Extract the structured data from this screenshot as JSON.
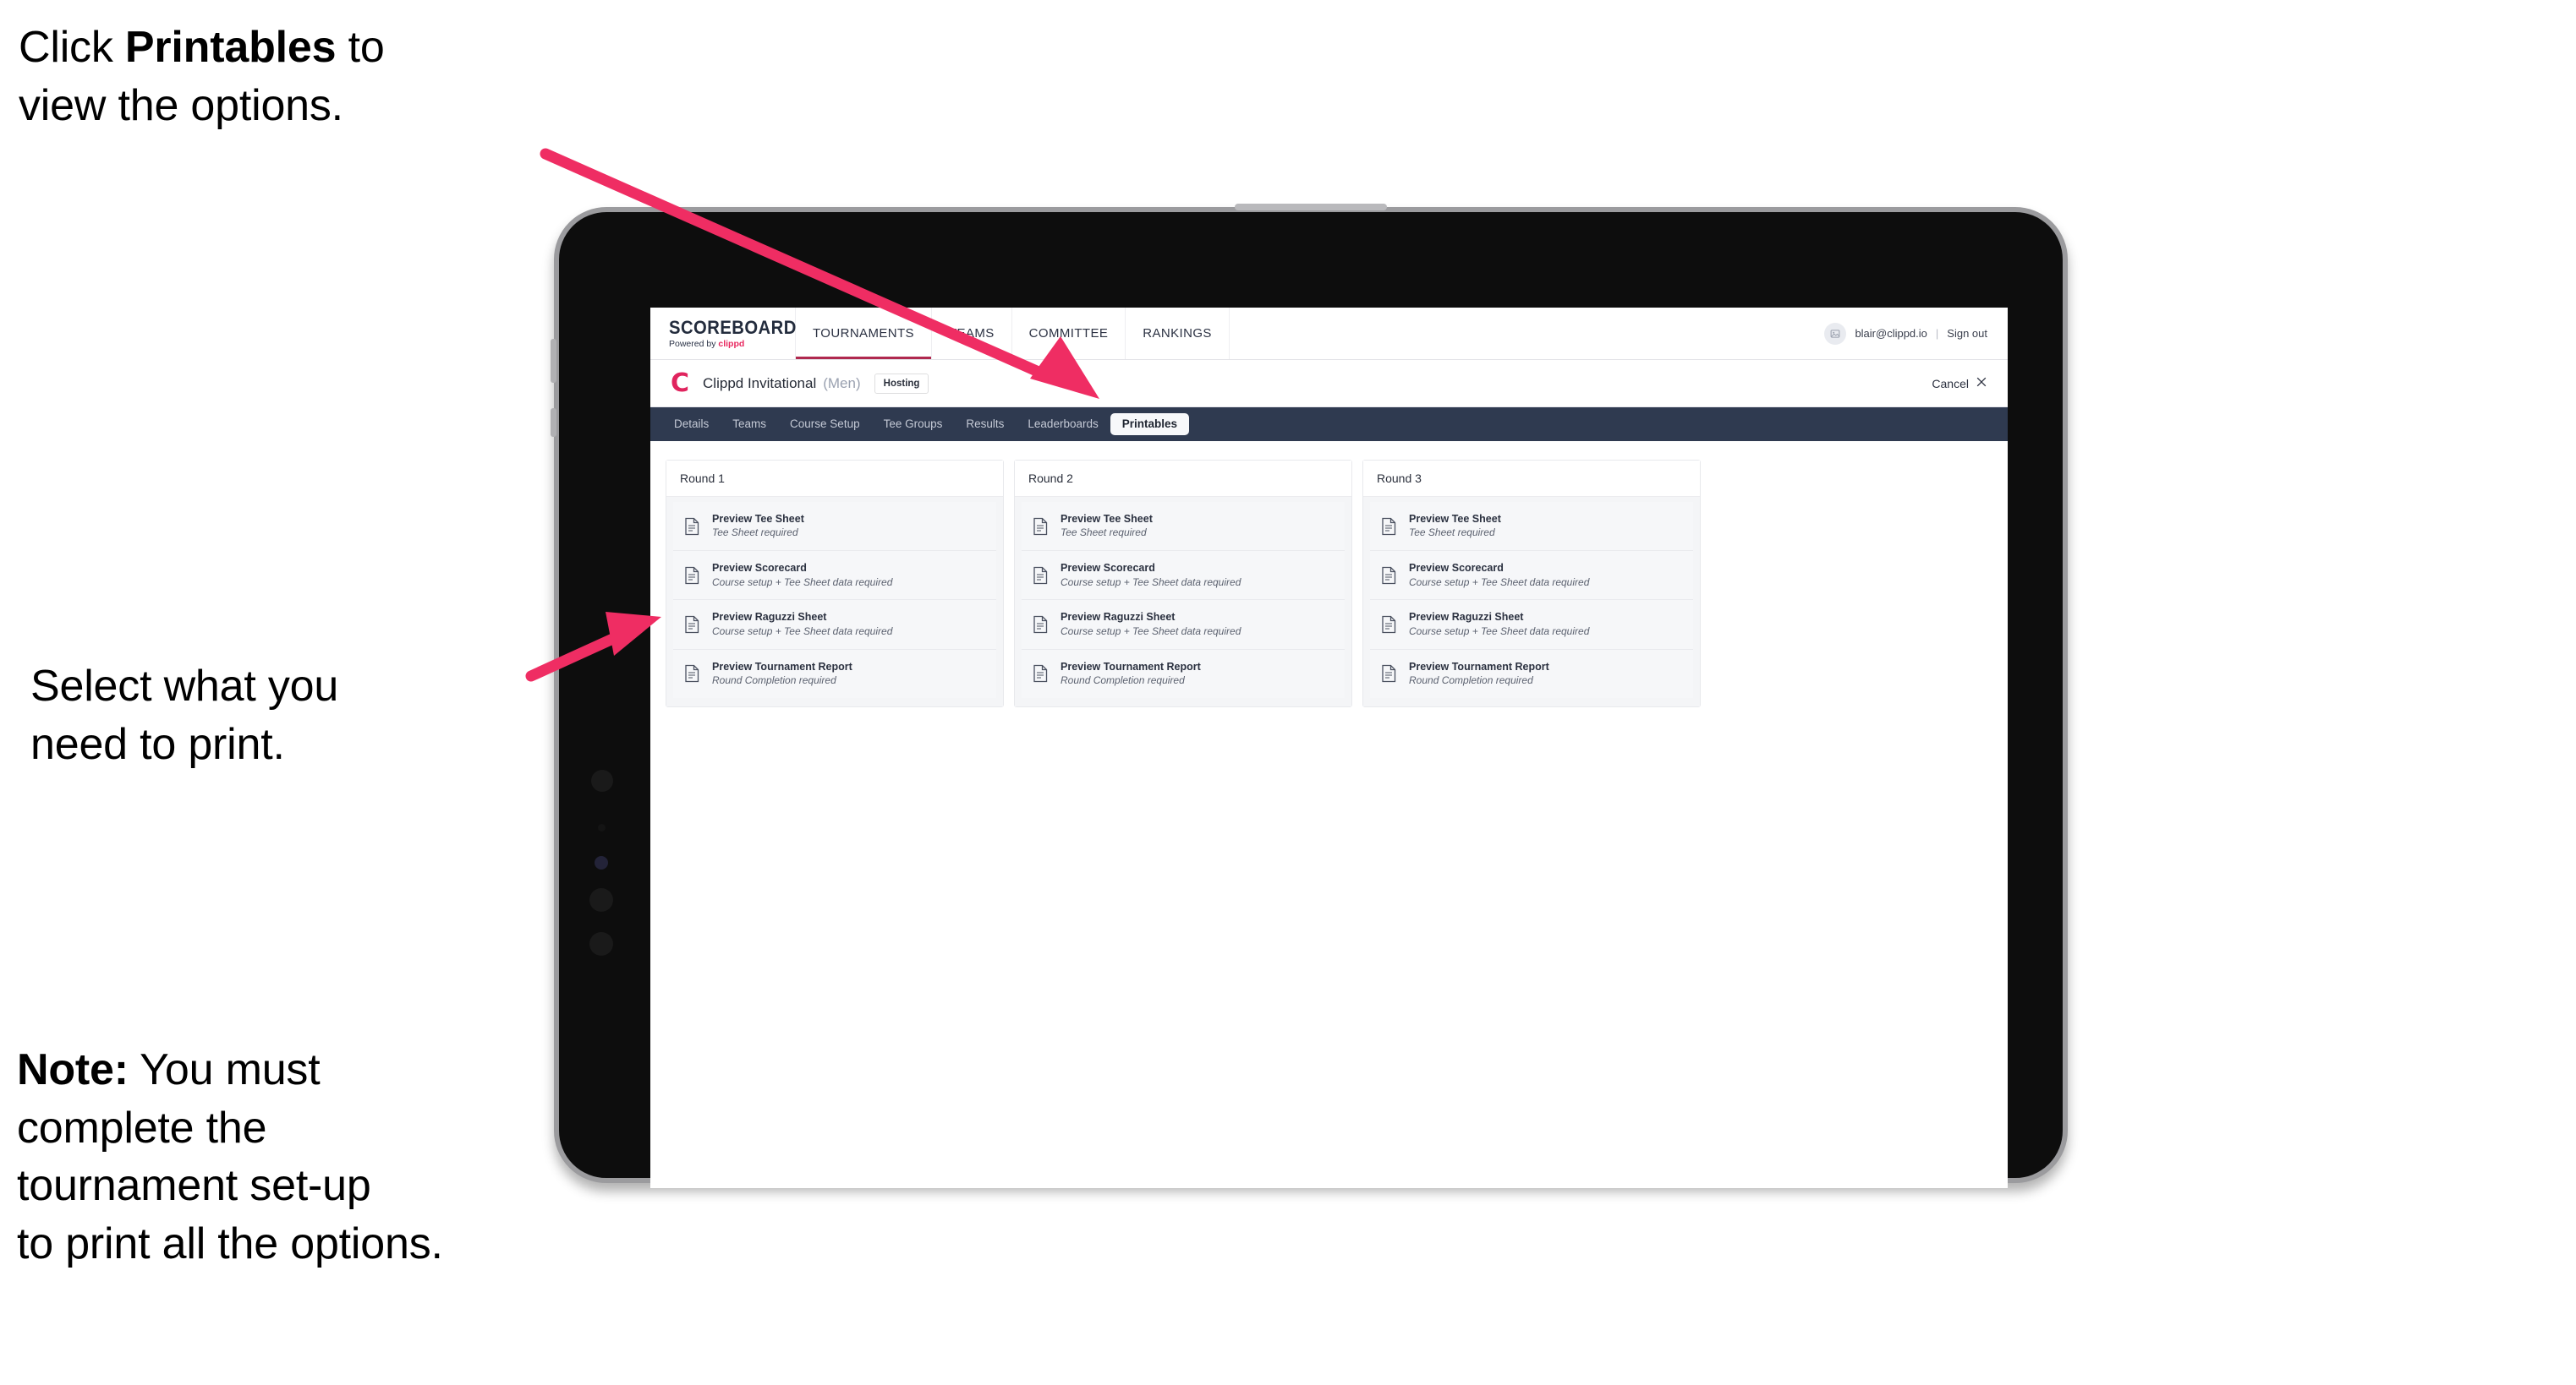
{
  "annotations": {
    "printables_hint": "Click Printables to\nview the options.",
    "printables_hint_pre": "Click ",
    "printables_hint_bold": "Printables",
    "printables_hint_post": " to\nview the options.",
    "select_hint": "Select what you\n need to print.",
    "note_label": "Note:",
    "note_body": " You must\ncomplete the\ntournament set-up\nto print all the options."
  },
  "colors": {
    "accent_pink": "#ef2d63",
    "brand_red": "#e0245e",
    "tabbar_dark": "#2f3a50",
    "nav_underline": "#b0294f",
    "text_dark": "#2b3140"
  },
  "browser": {
    "topnav": {
      "logo_word": "SCOREBOARD",
      "logo_sub_prefix": "Powered by ",
      "logo_sub_brand": "clippd",
      "items": [
        {
          "label": "TOURNAMENTS",
          "active": true
        },
        {
          "label": "TEAMS",
          "active": false
        },
        {
          "label": "COMMITTEE",
          "active": false
        },
        {
          "label": "RANKINGS",
          "active": false
        }
      ],
      "account": {
        "avatar_icon": "user-avatar-icon",
        "email": "blair@clippd.io",
        "separator": "|",
        "signout_label": "Sign out"
      }
    },
    "subheader": {
      "logo_letter": "C",
      "tournament_name": "Clippd Invitational",
      "gender": "(Men)",
      "status_badge": "Hosting",
      "cancel_label": "Cancel",
      "cancel_icon": "close-x-icon"
    },
    "tabs": [
      {
        "label": "Details",
        "active": false
      },
      {
        "label": "Teams",
        "active": false
      },
      {
        "label": "Course Setup",
        "active": false
      },
      {
        "label": "Tee Groups",
        "active": false
      },
      {
        "label": "Results",
        "active": false
      },
      {
        "label": "Leaderboards",
        "active": false
      },
      {
        "label": "Printables",
        "active": true
      }
    ],
    "rounds": [
      {
        "title": "Round 1",
        "items": [
          {
            "icon": "document-icon",
            "title": "Preview Tee Sheet",
            "subtitle": "Tee Sheet required"
          },
          {
            "icon": "document-icon",
            "title": "Preview Scorecard",
            "subtitle": "Course setup + Tee Sheet data required"
          },
          {
            "icon": "document-icon",
            "title": "Preview Raguzzi Sheet",
            "subtitle": "Course setup + Tee Sheet data required"
          },
          {
            "icon": "document-icon",
            "title": "Preview Tournament Report",
            "subtitle": "Round Completion required"
          }
        ]
      },
      {
        "title": "Round 2",
        "items": [
          {
            "icon": "document-icon",
            "title": "Preview Tee Sheet",
            "subtitle": "Tee Sheet required"
          },
          {
            "icon": "document-icon",
            "title": "Preview Scorecard",
            "subtitle": "Course setup + Tee Sheet data required"
          },
          {
            "icon": "document-icon",
            "title": "Preview Raguzzi Sheet",
            "subtitle": "Course setup + Tee Sheet data required"
          },
          {
            "icon": "document-icon",
            "title": "Preview Tournament Report",
            "subtitle": "Round Completion required"
          }
        ]
      },
      {
        "title": "Round 3",
        "items": [
          {
            "icon": "document-icon",
            "title": "Preview Tee Sheet",
            "subtitle": "Tee Sheet required"
          },
          {
            "icon": "document-icon",
            "title": "Preview Scorecard",
            "subtitle": "Course setup + Tee Sheet data required"
          },
          {
            "icon": "document-icon",
            "title": "Preview Raguzzi Sheet",
            "subtitle": "Course setup + Tee Sheet data required"
          },
          {
            "icon": "document-icon",
            "title": "Preview Tournament Report",
            "subtitle": "Round Completion required"
          }
        ]
      }
    ]
  }
}
